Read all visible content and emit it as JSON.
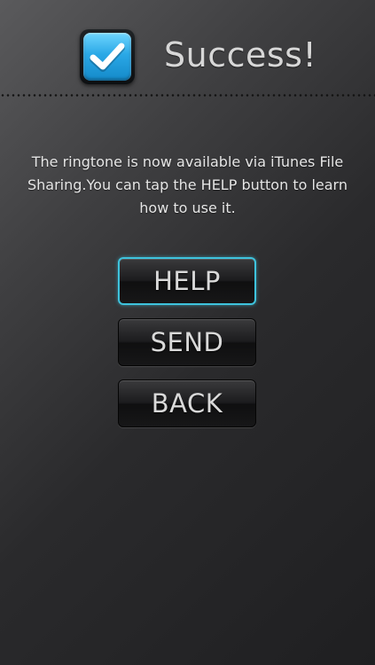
{
  "header": {
    "title": "Success!",
    "icon": "checkmark-icon",
    "icon_color": "#2aa8e6"
  },
  "message": {
    "text": "The ringtone is now available via iTunes File Sharing.You can tap the HELP button to learn how to use it."
  },
  "buttons": {
    "help_label": "HELP",
    "send_label": "SEND",
    "back_label": "BACK",
    "selected": "HELP",
    "accent_color": "#3ec3dd"
  }
}
